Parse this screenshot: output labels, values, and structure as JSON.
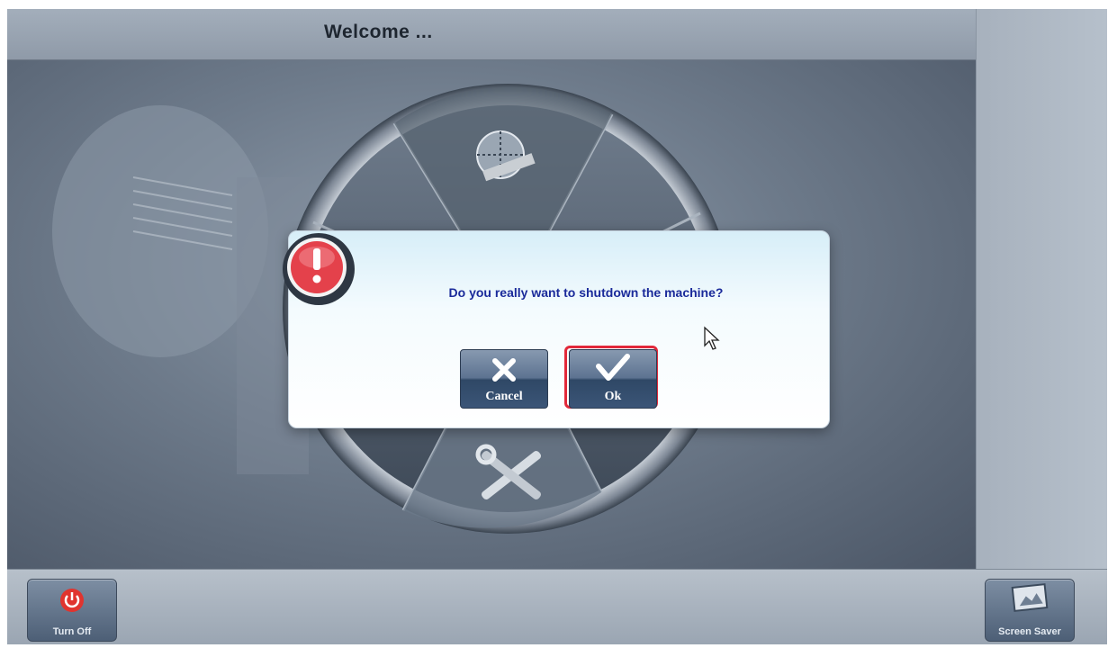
{
  "header": {
    "title": "Welcome ..."
  },
  "dialog": {
    "message": "Do you really want to shutdown the machine?",
    "cancel_label": "Cancel",
    "ok_label": "Ok"
  },
  "footer": {
    "turn_off_label": "Turn Off",
    "screen_saver_label": "Screen Saver"
  },
  "colors": {
    "dialog_text": "#1a2a9a",
    "highlight": "#e2283a",
    "power_icon": "#e0342f"
  },
  "icons": [
    "alert-icon",
    "measure-icon",
    "tools-icon",
    "power-icon",
    "screen-saver-icon",
    "x-icon",
    "check-icon",
    "mouse-cursor-icon"
  ]
}
